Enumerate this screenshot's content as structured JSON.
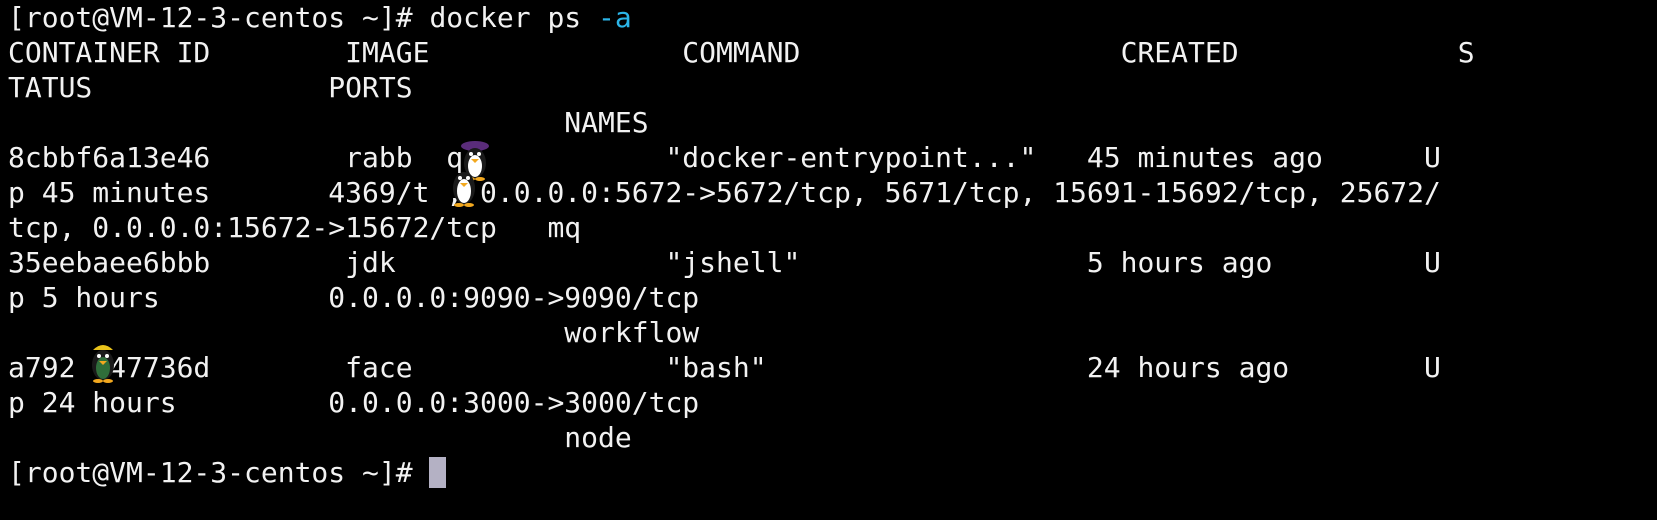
{
  "terminal": {
    "prompt": "[root@VM-12-3-centos ~]# ",
    "command": "docker ps ",
    "command_flag": "-a",
    "lines": [
      "CONTAINER ID        IMAGE               COMMAND                   CREATED             S",
      "TATUS              PORTS",
      "                                 NAMES",
      "8cbbf6a13e46        rabb  q            \"docker-entrypoint...\"   45 minutes ago      U",
      "p 45 minutes       4369/t , 0.0.0.0:5672->5672/tcp, 5671/tcp, 15691-15692/tcp, 25672/",
      "tcp, 0.0.0.0:15672->15672/tcp   mq",
      "35eebaee6bbb        jdk                \"jshell\"                 5 hours ago         U",
      "p 5 hours          0.0.0.0:9090->9090/tcp",
      "                                 workflow",
      "a792  47736d        face               \"bash\"                   24 hours ago        U",
      "p 24 hours         0.0.0.0:3000->3000/tcp",
      "                                 node"
    ],
    "final_prompt": "[root@VM-12-3-centos ~]# ",
    "colors": {
      "background": "#000000",
      "foreground": "#f2f2f2",
      "flag": "#2bb5e8",
      "cursor": "#b4b1c4"
    },
    "overlays": [
      "penguin-icon",
      "penguin-icon",
      "penguin-icon"
    ]
  }
}
